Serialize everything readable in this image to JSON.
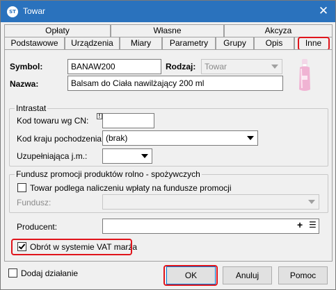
{
  "window": {
    "title": "Towar",
    "close_glyph": "✕",
    "app_icon_text": "ST"
  },
  "tabs_row1": [
    "Opłaty",
    "Własne",
    "Akcyza"
  ],
  "tabs_row2": [
    "Podstawowe",
    "Urządzenia",
    "Miary",
    "Parametry",
    "Grupy",
    "Opis",
    "Inne"
  ],
  "active_tab": "Inne",
  "header": {
    "symbol_label": "Symbol:",
    "symbol_value": "BANAW200",
    "rodzaj_label": "Rodzaj:",
    "rodzaj_value": "Towar",
    "nazwa_label": "Nazwa:",
    "nazwa_value": "Balsam do Ciała nawilżający 200 ml"
  },
  "intrastat": {
    "title": "Intrastat",
    "kod_cn_label": "Kod towaru wg CN:",
    "kod_cn_value": "",
    "kod_kraju_label": "Kod kraju pochodzenia:",
    "kod_kraju_value": "(brak)",
    "jm_label": "Uzupełniająca j.m.:",
    "jm_value": ""
  },
  "fundusz": {
    "title": "Fundusz promocji produktów rolno - spożywczych",
    "checkbox_label": "Towar podlega naliczeniu wpłaty na fundusze promocji",
    "checked": false,
    "fundusz_label": "Fundusz:",
    "fundusz_value": ""
  },
  "producent": {
    "label": "Producent:",
    "value": "",
    "add_glyph": "+",
    "list_glyph": "☰"
  },
  "vat_marza": {
    "label": "Obrót w systemie VAT marża",
    "checked": true
  },
  "footer": {
    "dodaj_label": "Dodaj działanie",
    "dodaj_checked": false,
    "ok_label": "OK",
    "anuluj_label": "Anuluj",
    "pomoc_label": "Pomoc"
  },
  "colors": {
    "titlebar": "#2a72bd",
    "highlight": "#e0141b",
    "dialog_bg": "#f0f0f0"
  }
}
